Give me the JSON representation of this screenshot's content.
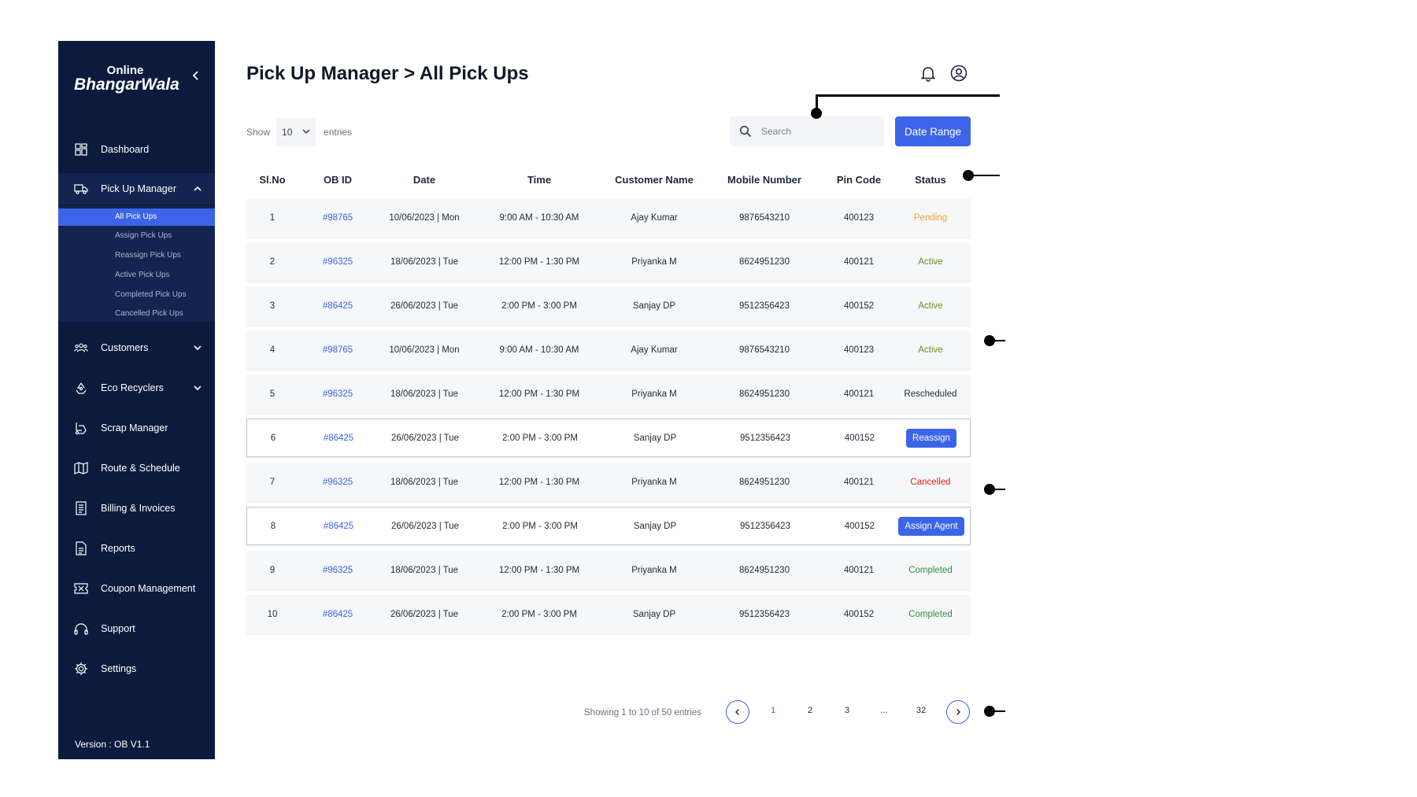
{
  "app": {
    "logo_top": "Online",
    "logo_main": "BhangarWala",
    "version": "Version : OB V1.1",
    "accent_color": "#3b64e8",
    "sidebar_color": "#0c1b3d"
  },
  "sidebar": {
    "items": [
      {
        "label": "Dashboard",
        "icon": "dashboard-icon"
      },
      {
        "label": "Pick Up Manager",
        "icon": "truck-icon",
        "expanded": true
      },
      {
        "label": "Customers",
        "icon": "users-icon"
      },
      {
        "label": "Eco Recyclers",
        "icon": "recycle-icon"
      },
      {
        "label": "Scrap Manager",
        "icon": "scrap-icon"
      },
      {
        "label": "Route & Schedule",
        "icon": "map-icon"
      },
      {
        "label": "Billing & Invoices",
        "icon": "invoice-icon"
      },
      {
        "label": "Reports",
        "icon": "report-icon"
      },
      {
        "label": "Coupon Management",
        "icon": "coupon-icon"
      },
      {
        "label": "Support",
        "icon": "headset-icon"
      },
      {
        "label": "Settings",
        "icon": "gear-icon"
      }
    ],
    "sub_items": [
      "All Pick Ups",
      "Assign Pick Ups",
      "Reassign Pick Ups",
      "Active Pick Ups",
      "Completed Pick Ups",
      "Cancelled Pick Ups"
    ]
  },
  "header": {
    "title": "Pick Up Manager > All Pick Ups"
  },
  "controls": {
    "show_label": "Show",
    "entries_value": "10",
    "entries_label": "entries",
    "search_placeholder": "Search",
    "date_range_label": "Date Range"
  },
  "table": {
    "columns": [
      "Sl.No",
      "OB ID",
      "Date",
      "Time",
      "Customer Name",
      "Mobile Number",
      "Pin Code",
      "Status"
    ],
    "rows": [
      {
        "sl": "1",
        "ob_id": "#98765",
        "date": "10/06/2023 | Mon",
        "time": "9:00 AM - 10:30 AM",
        "customer": "Ajay Kumar",
        "mobile": "9876543210",
        "pin": "400123",
        "status": "Pending",
        "status_type": "pending"
      },
      {
        "sl": "2",
        "ob_id": "#96325",
        "date": "18/06/2023 | Tue",
        "time": "12:00 PM - 1:30 PM",
        "customer": "Priyanka M",
        "mobile": "8624951230",
        "pin": "400121",
        "status": "Active",
        "status_type": "active"
      },
      {
        "sl": "3",
        "ob_id": "#86425",
        "date": "26/06/2023 | Tue",
        "time": "2:00 PM - 3:00 PM",
        "customer": "Sanjay DP",
        "mobile": "9512356423",
        "pin": "400152",
        "status": "Active",
        "status_type": "active"
      },
      {
        "sl": "4",
        "ob_id": "#98765",
        "date": "10/06/2023 | Mon",
        "time": "9:00 AM - 10:30 AM",
        "customer": "Ajay Kumar",
        "mobile": "9876543210",
        "pin": "400123",
        "status": "Active",
        "status_type": "active"
      },
      {
        "sl": "5",
        "ob_id": "#96325",
        "date": "18/06/2023 | Tue",
        "time": "12:00 PM - 1:30 PM",
        "customer": "Priyanka M",
        "mobile": "8624951230",
        "pin": "400121",
        "status": "Rescheduled",
        "status_type": "rescheduled"
      },
      {
        "sl": "6",
        "ob_id": "#86425",
        "date": "26/06/2023 | Tue",
        "time": "2:00 PM - 3:00 PM",
        "customer": "Sanjay DP",
        "mobile": "9512356423",
        "pin": "400152",
        "status": "Reassign",
        "status_type": "button"
      },
      {
        "sl": "7",
        "ob_id": "#96325",
        "date": "18/06/2023 | Tue",
        "time": "12:00 PM - 1:30 PM",
        "customer": "Priyanka M",
        "mobile": "8624951230",
        "pin": "400121",
        "status": "Cancelled",
        "status_type": "cancelled"
      },
      {
        "sl": "8",
        "ob_id": "#86425",
        "date": "26/06/2023 | Tue",
        "time": "2:00 PM - 3:00 PM",
        "customer": "Sanjay DP",
        "mobile": "9512356423",
        "pin": "400152",
        "status": "Assign Agent",
        "status_type": "button"
      },
      {
        "sl": "9",
        "ob_id": "#96325",
        "date": "18/06/2023 | Tue",
        "time": "12:00 PM - 1:30 PM",
        "customer": "Priyanka M",
        "mobile": "8624951230",
        "pin": "400121",
        "status": "Completed",
        "status_type": "completed"
      },
      {
        "sl": "10",
        "ob_id": "#86425",
        "date": "26/06/2023 | Tue",
        "time": "2:00 PM - 3:00 PM",
        "customer": "Sanjay DP",
        "mobile": "9512356423",
        "pin": "400152",
        "status": "Completed",
        "status_type": "completed"
      }
    ]
  },
  "pagination": {
    "info": "Showing 1 to 10 of 50 entries",
    "pages": [
      "1",
      "2",
      "3",
      "...",
      "32"
    ],
    "current": "1"
  }
}
